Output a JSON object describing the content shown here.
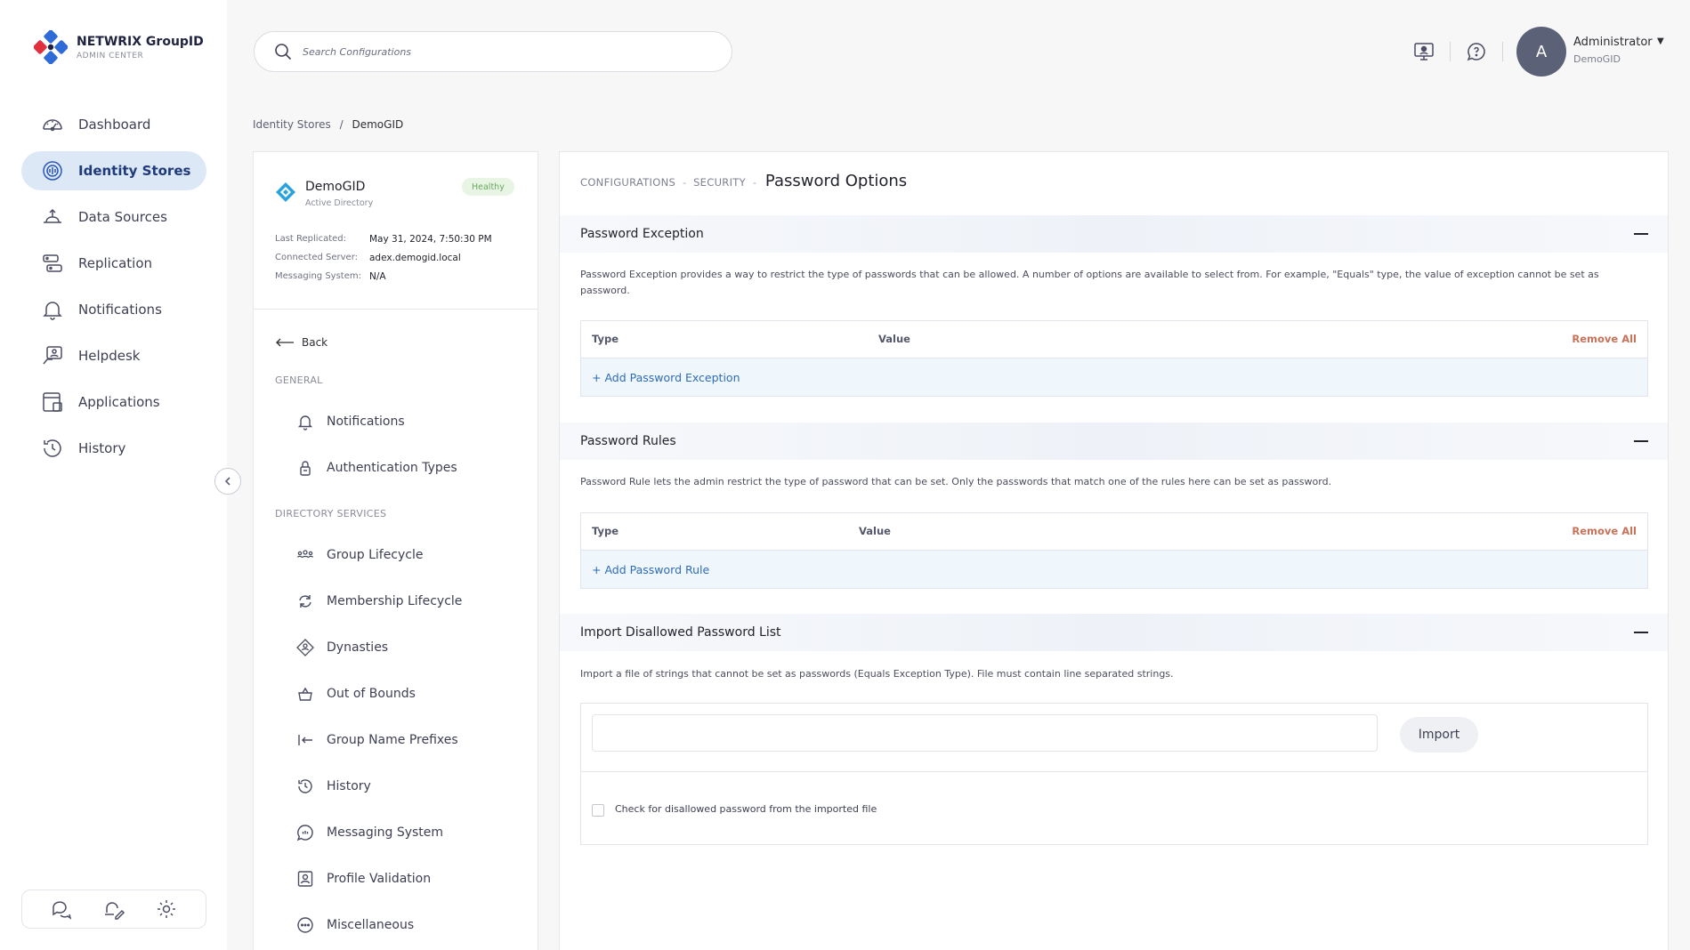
{
  "app": {
    "brand": "NETWRIX GroupID",
    "subtitle": "ADMIN CENTER"
  },
  "sidebar": {
    "items": [
      {
        "label": "Dashboard",
        "icon": "dashboard-icon"
      },
      {
        "label": "Identity Stores",
        "icon": "identity-stores-icon",
        "active": true
      },
      {
        "label": "Data Sources",
        "icon": "data-sources-icon"
      },
      {
        "label": "Replication",
        "icon": "replication-icon"
      },
      {
        "label": "Notifications",
        "icon": "bell-icon"
      },
      {
        "label": "Helpdesk",
        "icon": "helpdesk-icon"
      },
      {
        "label": "Applications",
        "icon": "applications-icon"
      },
      {
        "label": "History",
        "icon": "history-icon"
      }
    ],
    "bottom_tools": [
      "chat-icon",
      "bell-pen-icon",
      "gear-icon"
    ]
  },
  "search": {
    "placeholder": "Search Configurations"
  },
  "user": {
    "initial": "A",
    "name": "Administrator",
    "org": "DemoGID",
    "caret": "▼"
  },
  "breadcrumb": {
    "root": "Identity Stores",
    "separator": "/",
    "current": "DemoGID"
  },
  "store": {
    "name": "DemoGID",
    "type": "Active Directory",
    "status": "Healthy",
    "meta": [
      {
        "label": "Last Replicated:",
        "value": "May 31, 2024, 7:50:30 PM"
      },
      {
        "label": "Connected Server:",
        "value": "adex.demogid.local"
      },
      {
        "label": "Messaging System:",
        "value": "N/A"
      }
    ]
  },
  "subnav": {
    "back": "Back",
    "general_heading": "GENERAL",
    "general": [
      {
        "label": "Notifications",
        "icon": "bell-icon"
      },
      {
        "label": "Authentication Types",
        "icon": "lock-icon"
      }
    ],
    "directory_heading": "DIRECTORY SERVICES",
    "directory": [
      {
        "label": "Group Lifecycle",
        "icon": "group-icon"
      },
      {
        "label": "Membership Lifecycle",
        "icon": "cycle-icon"
      },
      {
        "label": "Dynasties",
        "icon": "dynasty-icon"
      },
      {
        "label": "Out of Bounds",
        "icon": "basket-icon"
      },
      {
        "label": "Group Name Prefixes",
        "icon": "prefix-icon"
      },
      {
        "label": "History",
        "icon": "history-icon"
      },
      {
        "label": "Messaging System",
        "icon": "message-icon"
      },
      {
        "label": "Profile Validation",
        "icon": "profile-icon"
      },
      {
        "label": "Miscellaneous",
        "icon": "dots-icon"
      }
    ]
  },
  "page": {
    "crumb1": "CONFIGURATIONS",
    "crumb2": "SECURITY",
    "dash": "-",
    "title": "Password Options"
  },
  "exception": {
    "heading": "Password Exception",
    "description": "Password Exception provides a way to restrict the type of passwords that can be allowed. A number of options are available to select from. For example, \"Equals\" type, the value of exception cannot be set as password.",
    "col_type": "Type",
    "col_value": "Value",
    "remove_all": "Remove All",
    "add": "+ Add Password Exception"
  },
  "rules": {
    "heading": "Password Rules",
    "description": "Password Rule lets the admin restrict the type of password that can be set. Only the passwords that match one of the rules here can be set as password.",
    "col_type": "Type",
    "col_value": "Value",
    "remove_all": "Remove All",
    "add": "+ Add Password Rule"
  },
  "import": {
    "heading": "Import Disallowed Password List",
    "description": "Import a file of strings that cannot be set as passwords (Equals Exception Type). File must contain line separated strings.",
    "input_value": "",
    "button": "Import",
    "checkbox_label": "Check for disallowed password from the imported file",
    "checked": false
  },
  "colors": {
    "accent": "#2a56b8",
    "active_bg": "#dde8f7",
    "remove": "#c9725a",
    "link": "#2d6bb8",
    "healthy": "#68a85c"
  }
}
